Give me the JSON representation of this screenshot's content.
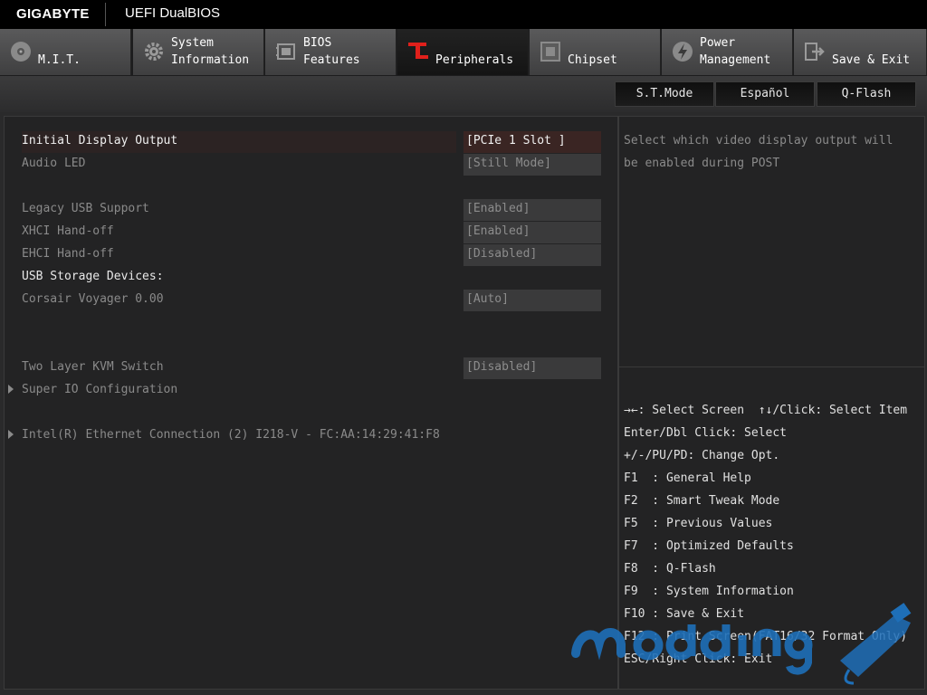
{
  "header": {
    "brand": "GIGABYTE",
    "product": "UEFI DualBIOS"
  },
  "tabs": [
    {
      "label": "M.I.T.",
      "icon": "disc-icon"
    },
    {
      "label": "System\nInformation",
      "icon": "gear-icon"
    },
    {
      "label": "BIOS\nFeatures",
      "icon": "bios-chip-icon"
    },
    {
      "label": "Peripherals",
      "icon": "peripherals-icon",
      "active": true
    },
    {
      "label": "Chipset",
      "icon": "chip-icon"
    },
    {
      "label": "Power\nManagement",
      "icon": "power-icon"
    },
    {
      "label": "Save & Exit",
      "icon": "exit-icon"
    }
  ],
  "toolbar": {
    "st_mode": "S.T.Mode",
    "language": "Español",
    "qflash": "Q-Flash"
  },
  "settings": {
    "initial_display_output": {
      "label": "Initial Display Output",
      "value": "[PCIe 1 Slot ]"
    },
    "audio_led": {
      "label": "Audio LED",
      "value": "[Still Mode]"
    },
    "legacy_usb": {
      "label": "Legacy USB Support",
      "value": "[Enabled]"
    },
    "xhci": {
      "label": "XHCI Hand-off",
      "value": "[Enabled]"
    },
    "ehci": {
      "label": "EHCI Hand-off",
      "value": "[Disabled]"
    },
    "usb_storage_header": "USB Storage Devices:",
    "corsair": {
      "label": "Corsair Voyager 0.00",
      "value": "[Auto]"
    },
    "kvm": {
      "label": "Two Layer KVM Switch",
      "value": "[Disabled]"
    },
    "super_io": "Super IO Configuration",
    "ethernet": "Intel(R) Ethernet Connection (2) I218-V - FC:AA:14:29:41:F8"
  },
  "help_text": "Select which video display output will\nbe enabled during POST",
  "key_help": [
    "→←: Select Screen  ↑↓/Click: Select Item",
    "Enter/Dbl Click: Select",
    "+/-/PU/PD: Change Opt.",
    "F1  : General Help",
    "F2  : Smart Tweak Mode",
    "F5  : Previous Values",
    "F7  : Optimized Defaults",
    "F8  : Q-Flash",
    "F9  : System Information",
    "F10 : Save & Exit",
    "F12 : Print Screen(FAT16/32 Format Only)",
    "ESC/Right Click: Exit"
  ],
  "watermark": "moddingmx",
  "colors": {
    "accent": "#e0201b",
    "background": "#2a2a2b",
    "selected_row": "#3a2523"
  }
}
